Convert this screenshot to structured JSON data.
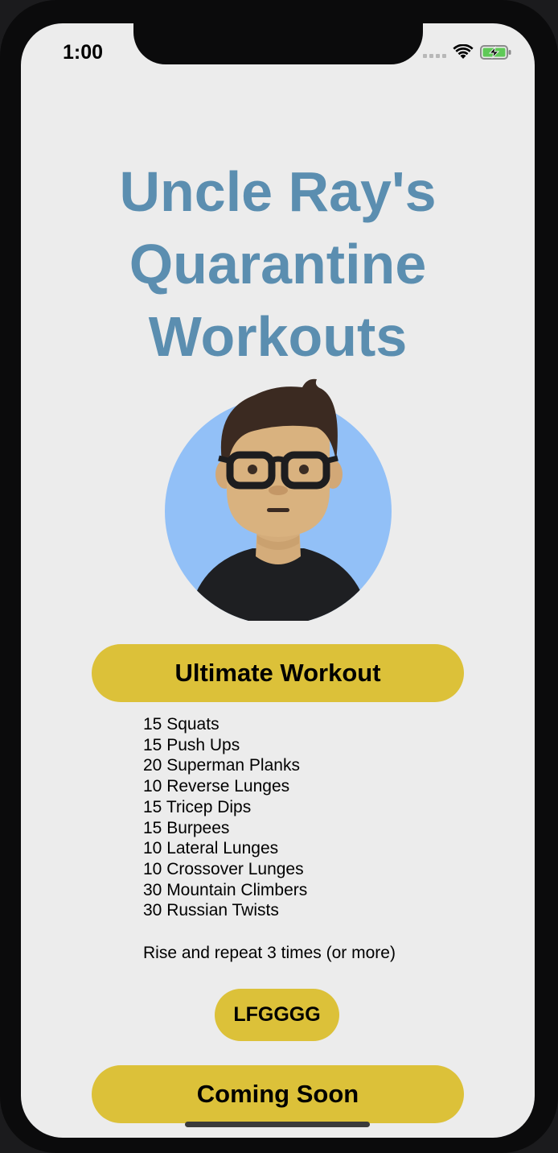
{
  "status_bar": {
    "time": "1:00"
  },
  "header": {
    "title_lines": [
      "Uncle Ray's",
      "Quarantine",
      "Workouts"
    ]
  },
  "avatar": {
    "icon": "avatar-memoji"
  },
  "buttons": {
    "ultimate_workout": "Ultimate Workout",
    "lfg": "LFGGGG",
    "coming_soon": "Coming Soon"
  },
  "workout": {
    "exercises": [
      "15 Squats",
      "15 Push Ups",
      "20 Superman Planks",
      "10 Reverse Lunges",
      "15 Tricep Dips",
      "15 Burpees",
      "10 Lateral Lunges",
      "10 Crossover Lunges",
      "30 Mountain Climbers",
      "30 Russian Twists"
    ],
    "repeat_note": "Rise and repeat 3 times (or more)"
  },
  "colors": {
    "title": "#5b8eb0",
    "button": "#dcc139",
    "screen_bg": "#ececec",
    "avatar_bg": "#92c0f7"
  }
}
